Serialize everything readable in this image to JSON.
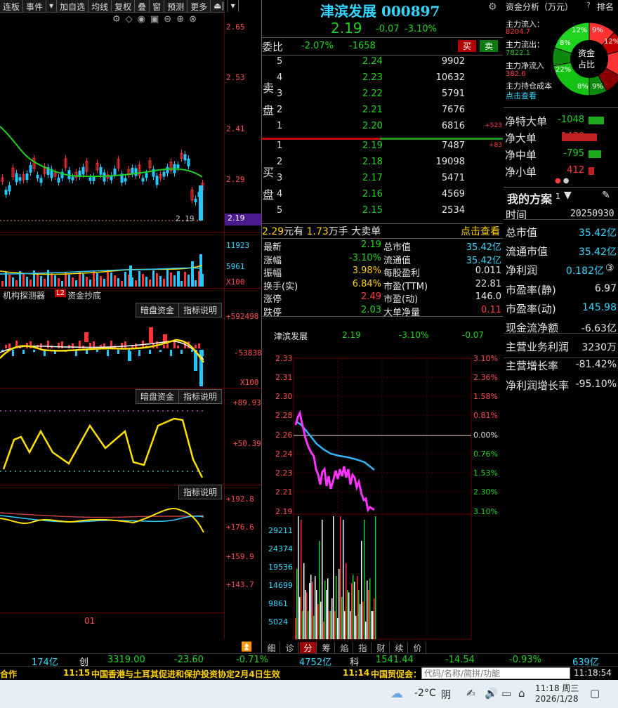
{
  "toolbar": {
    "items": [
      "连板",
      "事件",
      "▾",
      "加自选",
      "均线",
      "复权",
      "叠",
      "窗",
      "预测",
      "更多",
      "⏏|",
      "▾"
    ]
  },
  "stock": {
    "name": "津滨发展",
    "code": "000897",
    "price": "2.19",
    "change": "-0.07",
    "pct": "-3.10%"
  },
  "kline_axis": [
    "2.65",
    "2.53",
    "2.41",
    "2.29",
    "2.19"
  ],
  "kline_last_label": "2.19",
  "vol_axis": [
    "11923",
    "5961",
    "X100"
  ],
  "panel_tabs": {
    "tab1": "机构探测器",
    "badge": "L2",
    "tab2": "资金抄底"
  },
  "indicator_buttons": {
    "dark": "暗盘资金",
    "explain": "指标说明"
  },
  "fund_axis": [
    "+592498",
    "-53838",
    "X100"
  ],
  "osc1_axis": [
    "+89.93",
    "+50.39"
  ],
  "osc2_axis": [
    "+192.8",
    "+176.6",
    "+159.9",
    "+143.7"
  ],
  "date_label": "01",
  "weibi": {
    "label": "委比",
    "pct": "-2.07%",
    "diff": "-1658",
    "buy": "买",
    "sell": "卖"
  },
  "orderbook": {
    "sell_label": [
      "卖",
      "盘"
    ],
    "buy_label": [
      "买",
      "盘"
    ],
    "sells": [
      {
        "n": "5",
        "p": "2.24",
        "v": "9902",
        "d": ""
      },
      {
        "n": "4",
        "p": "2.23",
        "v": "10632",
        "d": ""
      },
      {
        "n": "3",
        "p": "2.22",
        "v": "5791",
        "d": ""
      },
      {
        "n": "2",
        "p": "2.21",
        "v": "7676",
        "d": ""
      },
      {
        "n": "1",
        "p": "2.20",
        "v": "6816",
        "d": "+523"
      }
    ],
    "buys": [
      {
        "n": "1",
        "p": "2.19",
        "v": "7487",
        "d": "+83"
      },
      {
        "n": "2",
        "p": "2.18",
        "v": "19098",
        "d": ""
      },
      {
        "n": "3",
        "p": "2.17",
        "v": "5471",
        "d": ""
      },
      {
        "n": "4",
        "p": "2.16",
        "v": "4569",
        "d": ""
      },
      {
        "n": "5",
        "p": "2.15",
        "v": "2534",
        "d": ""
      }
    ]
  },
  "bigorder": {
    "price": "2.29",
    "unit1": "元有",
    "vol": "1.73",
    "unit2": "万手",
    "label": "大卖单",
    "link": "点击查看"
  },
  "stats_left": [
    {
      "k": "最新",
      "v": "2.19",
      "c": "grn"
    },
    {
      "k": "涨幅",
      "v": "-3.10%",
      "c": "grn"
    },
    {
      "k": "振幅",
      "v": "3.98%",
      "c": "yel"
    },
    {
      "k": "换手(实)",
      "v": "6.84%",
      "c": "yel"
    },
    {
      "k": "涨停",
      "v": "2.49",
      "c": "red"
    },
    {
      "k": "跌停",
      "v": "2.03",
      "c": "grn"
    }
  ],
  "stats_right": [
    {
      "k": "总市值",
      "v": "35.42亿",
      "c": "cyan"
    },
    {
      "k": "流通值",
      "v": "35.42亿",
      "c": "cyan"
    },
    {
      "k": "每股盈利",
      "v": "0.011",
      "c": "wht"
    },
    {
      "k": "市盈(TTM)",
      "v": "22.81",
      "c": "wht"
    },
    {
      "k": "市盈(动)",
      "v": "146.0",
      "c": "wht"
    },
    {
      "k": "大单净量",
      "v": "0.11",
      "c": "red"
    }
  ],
  "intraday": {
    "name": "津滨发展",
    "price": "2.19",
    "pct": "-3.10%",
    "chg": "-0.07",
    "left_axis": [
      "2.33",
      "2.31",
      "2.30",
      "2.28",
      "2.26",
      "2.24",
      "2.23",
      "2.21",
      "2.19"
    ],
    "right_axis": [
      "3.10%",
      "2.36%",
      "1.58%",
      "0.81%",
      "0.00%",
      "0.76%",
      "1.53%",
      "2.30%",
      "3.10%"
    ],
    "vol_axis": [
      "29211",
      "24374",
      "19536",
      "14699",
      "9861",
      "5024"
    ],
    "tabs": [
      "细",
      "诊",
      "分",
      "筹",
      "焰",
      "指",
      "财",
      "续",
      "价"
    ],
    "active_tab": 2
  },
  "fund": {
    "title": "资金分析（万元）",
    "rank": "排名",
    "inflow_label": "主力流入：",
    "inflow": "8204.7",
    "outflow_label": "主力流出：",
    "outflow": "7822.1",
    "net_label": "主力净流入",
    "net": "382.6",
    "cost_label": "主力持仓成本",
    "cost_link": "点击查看",
    "pie_center": [
      "资金",
      "占比"
    ],
    "pie_pcts": [
      "12%",
      "9%",
      "12%",
      "9%",
      "8%",
      "22%",
      "8%"
    ]
  },
  "net_flows": [
    {
      "k": "净特大单",
      "v": "-1048",
      "c": "grn",
      "bar": 0.55
    },
    {
      "k": "净大单",
      "v": "1430",
      "c": "red",
      "bar": 0.75
    },
    {
      "k": "净中单",
      "v": "-795",
      "c": "grn",
      "bar": 0.45
    },
    {
      "k": "净小单",
      "v": "412",
      "c": "red",
      "bar": 0.2
    }
  ],
  "plan": {
    "title": "我的方案",
    "num": "1",
    "time_label": "时间",
    "time": "20250930",
    "rows": [
      {
        "k": "总市值",
        "v": "35.42亿",
        "c": "cyan"
      },
      {
        "k": "流通市值",
        "v": "35.42亿",
        "c": "cyan"
      },
      {
        "k": "净利润",
        "v": "0.182亿",
        "c": "cyan",
        "extra": "③"
      },
      {
        "k": "市盈率(静)",
        "v": "6.97",
        "c": "wht"
      },
      {
        "k": "市盈率(动)",
        "v": "145.98",
        "c": "cyan"
      },
      {
        "k": "现金流净额",
        "v": "-6.63亿",
        "c": "wht"
      },
      {
        "k": "主营业务利润",
        "v": "3230万",
        "c": "wht"
      },
      {
        "k": "主营增长率",
        "v": "-81.42%",
        "c": "wht"
      },
      {
        "k": "净利润增长率",
        "v": "-95.10%",
        "c": "wht"
      }
    ]
  },
  "status": {
    "a": "174亿",
    "b": "创",
    "c": "3319.00",
    "d": "-23.60",
    "e": "-0.71%",
    "f": "4752亿",
    "g": "科",
    "h": "1541.44",
    "i": "-14.54",
    "j": "-0.93%",
    "k": "639亿"
  },
  "ticker": {
    "left": "合作",
    "t1": "11:15",
    "n1": "中国香港与土耳其促进和保护投资协定2月4日生效",
    "t2": "11:14",
    "n2": "中国贸促会：",
    "search_placeholder": "代码/名称/简拼/功能",
    "clock": "11:18:54"
  },
  "taskbar": {
    "temp": "-2°C",
    "weather": "阴",
    "time": "11:18 周三",
    "date": "2026/1/28"
  }
}
